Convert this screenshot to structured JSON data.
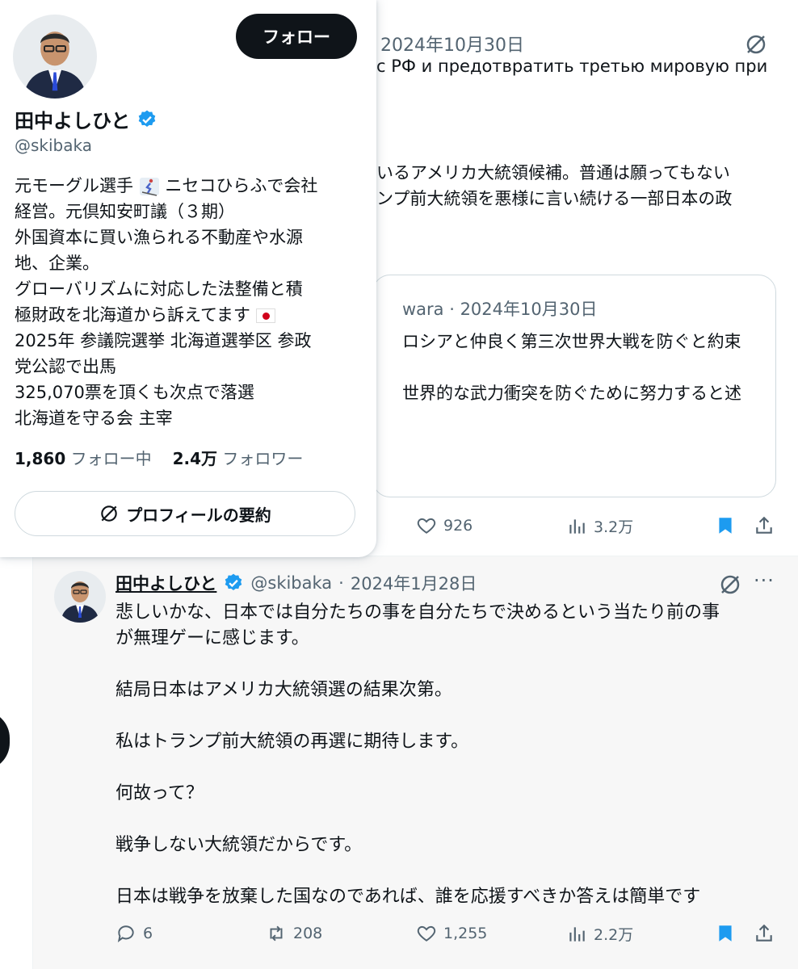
{
  "background_tweet": {
    "date_partial": "2024年10月30日",
    "lines": [
      "с РФ и предотвратить третью мировую при",
      "いるアメリカ大統領候補。普通は願ってもない",
      "ンプ前大統領を悪様に言い続ける一部日本の政"
    ],
    "quote": {
      "meta": "wara · 2024年10月30日",
      "lines": [
        "ロシアと仲良く第三次世界大戦を防ぐと約束",
        "世界的な武力衝突を防ぐために努力すると述"
      ]
    },
    "actions": {
      "likes": "926",
      "views": "3.2万"
    }
  },
  "hover_card": {
    "follow_label": "フォロー",
    "name": "田中よしひと",
    "handle": "@skibaka",
    "bio_lines": [
      "元モーグル選手",
      "ニセコひらふで会社",
      "経営。元倶知安町議（３期）",
      "外国資本に買い漁られる不動産や水源",
      "地、企業。",
      "グローバリズムに対応した法整備と積",
      "極財政を北海道から訴えてます",
      "2025年 参議院選挙 北海道選挙区 参政",
      "党公認で出馬",
      "325,070票を頂くも次点で落選",
      "北海道を守る会 主宰"
    ],
    "following_count": "1,860",
    "following_label": "フォロー中",
    "followers_count": "2.4万",
    "followers_label": "フォロワー",
    "summary_label": "プロフィールの要約"
  },
  "tweet": {
    "name": "田中よしひと",
    "handle": "@skibaka",
    "sep": "·",
    "date": "2024年1月28日",
    "more": "···",
    "body": [
      "悲しいかな、日本では自分たちの事を自分たちで決めるという当たり前の事",
      "が無理ゲーに感じます。",
      "",
      "結局日本はアメリカ大統領選の結果次第。",
      "",
      "私はトランプ前大統領の再選に期待します。",
      "",
      "何故って？",
      "",
      "戦争しない大統領だからです。",
      "",
      "日本は戦争を放棄した国なのであれば、誰を応援すべきか答えは簡単です"
    ],
    "actions": {
      "replies": "6",
      "reposts": "208",
      "likes": "1,255",
      "views": "2.2万"
    }
  },
  "colors": {
    "text": "#0f1419",
    "muted": "#536471",
    "verified": "#1d9bf0",
    "bookmark": "#1d9bf0",
    "highlight_bg": "#f7f7f7"
  }
}
